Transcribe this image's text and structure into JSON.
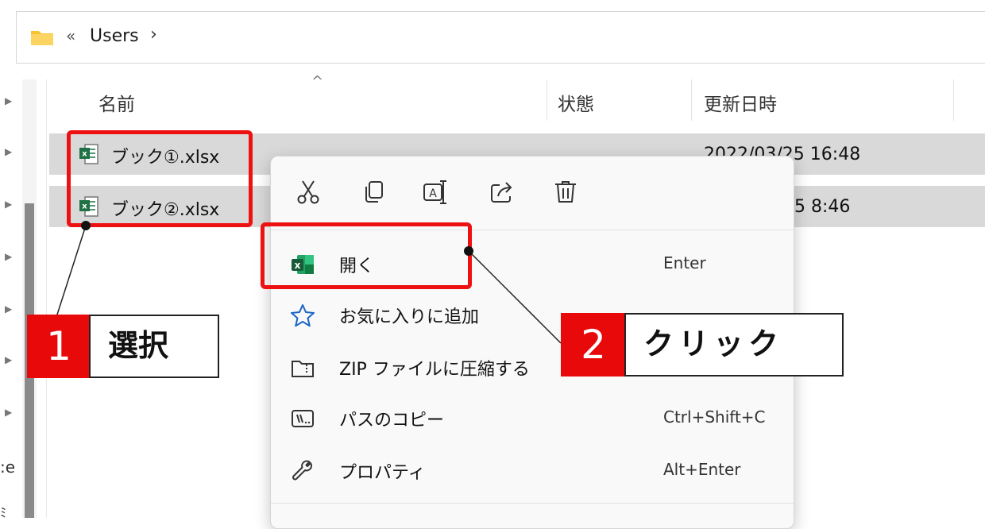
{
  "address_bar": {
    "overflow_chevron": "«",
    "segment": "Users",
    "separator": "›"
  },
  "nav_pane": {
    "partial_labels": [
      ":e",
      "ﾐ"
    ]
  },
  "columns": {
    "name": "名前",
    "status": "状態",
    "modified": "更新日時",
    "sort_caret": "^"
  },
  "files": [
    {
      "name": "ブック①.xlsx",
      "modified": "2022/03/25 16:48"
    },
    {
      "name": "ブック②.xlsx",
      "modified": "5 8:46"
    }
  ],
  "context_menu": {
    "toolbar": [
      "cut-icon",
      "copy-icon",
      "rename-icon",
      "share-icon",
      "delete-icon"
    ],
    "items": [
      {
        "label": "開く",
        "shortcut": "Enter",
        "icon": "excel-icon"
      },
      {
        "label": "お気に入りに追加",
        "shortcut": "",
        "icon": "star-icon"
      },
      {
        "label": "ZIP ファイルに圧縮する",
        "shortcut": "",
        "icon": "zip-folder-icon"
      },
      {
        "label": "パスのコピー",
        "shortcut": "Ctrl+Shift+C",
        "icon": "copy-path-icon"
      },
      {
        "label": "プロパティ",
        "shortcut": "Alt+Enter",
        "icon": "wrench-icon"
      }
    ]
  },
  "callouts": [
    {
      "number": "1",
      "text": "選択"
    },
    {
      "number": "2",
      "text": "クリック"
    }
  ],
  "colors": {
    "highlight": "#ee1111",
    "callout_red": "#e80a0a",
    "selected_row": "#d9d9d9",
    "excel_green": "#1e7145",
    "folder_yellow": "#f8c231"
  }
}
